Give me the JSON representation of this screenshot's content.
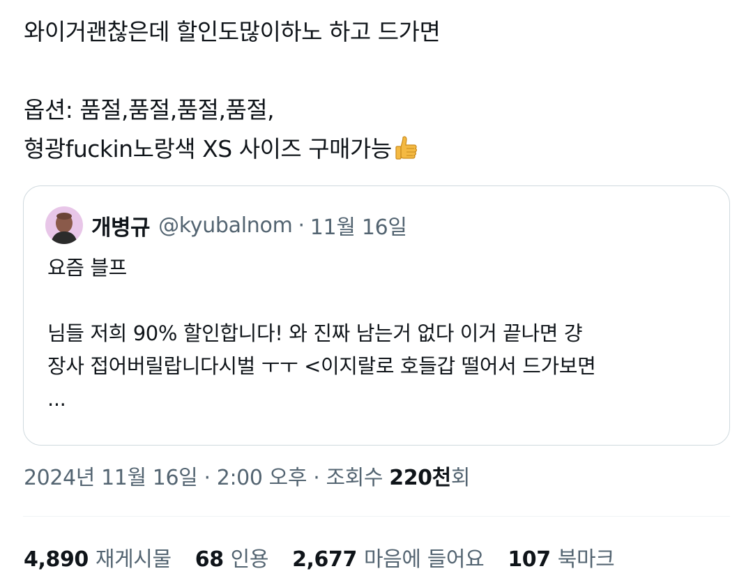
{
  "tweet": {
    "line1": "와이거괜찮은데 할인도많이하노 하고 드가면",
    "line2": "옵션: 품절,품절,품절,품절,",
    "line3": "형광fuckin노랑색 XS 사이즈 구매가능",
    "emoji_icon": "thumbs-up-icon"
  },
  "quote": {
    "name": "개병규",
    "handle": "@kyubalnom",
    "separator": "·",
    "date": "11월 16일",
    "line1": "요즘 블프",
    "line2": "님들 저희 90% 할인합니다! 와 진짜 남는거 없다 이거 끝나면 걍",
    "line3": "장사 접어버릴랍니다시벌 ㅜㅜ <이지랄로 호들갑 떨어서 드가보면",
    "line4": "..."
  },
  "meta": {
    "datetime": "2024년 11월 16일 · 2:00 오후 · 조회수 ",
    "views": "220천",
    "views_suffix": "회"
  },
  "stats": [
    {
      "count": "4,890",
      "label": "재게시물"
    },
    {
      "count": "68",
      "label": "인용"
    },
    {
      "count": "2,677",
      "label": "마음에 들어요"
    },
    {
      "count": "107",
      "label": "북마크"
    }
  ],
  "colors": {
    "text": "#0f1419",
    "muted": "#536471",
    "border": "#cfd9de",
    "emoji": "#f4b942"
  }
}
